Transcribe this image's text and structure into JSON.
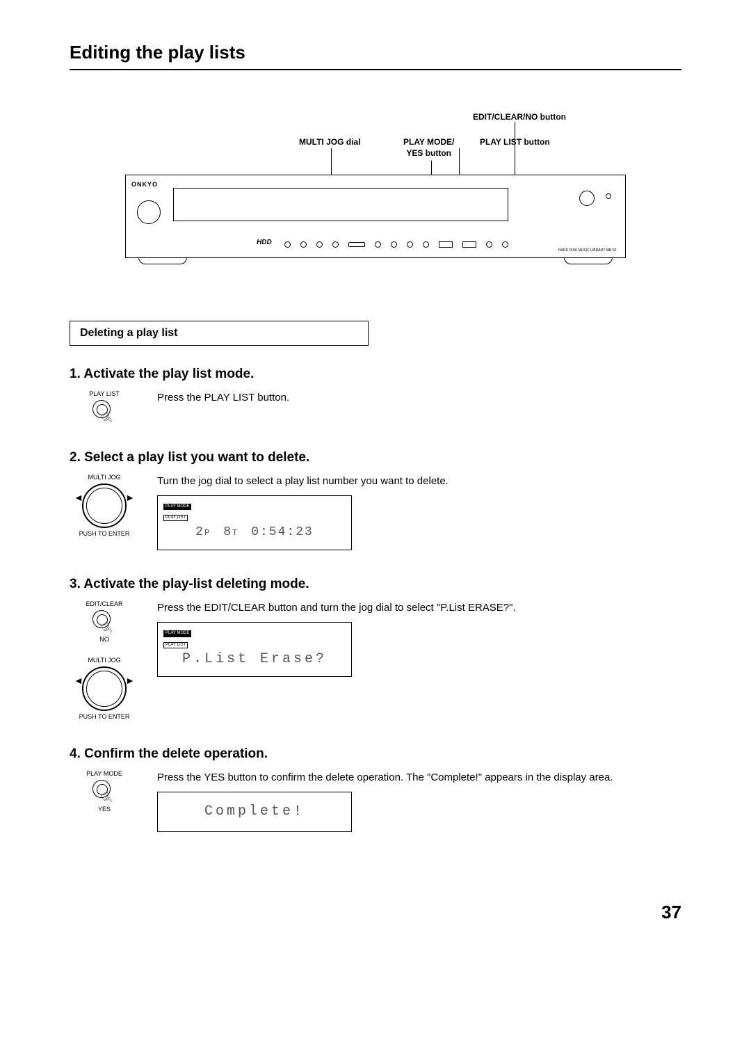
{
  "title": "Editing the play lists",
  "page_number": "37",
  "diagram": {
    "callout_edit": "EDIT/CLEAR/NO button",
    "callout_multi_jog": "MULTI JOG dial",
    "callout_play_mode": "PLAY MODE/\nYES button",
    "callout_play_list": "PLAY LIST button",
    "brand": "ONKYO",
    "hdd": "HDD",
    "model": "HARD DISK MUSIC LIBRARY MB-S1"
  },
  "section_box": "Deleting a play list",
  "steps": [
    {
      "heading": "1. Activate the play list mode.",
      "icon_label_top": "PLAY LIST",
      "body": "Press the PLAY LIST button."
    },
    {
      "heading": "2. Select a play list you want to delete.",
      "icon_label_top": "MULTI JOG",
      "icon_label_bottom": "PUSH TO ENTER",
      "body": "Turn the jog dial to select a play list number you want to delete.",
      "display": {
        "tags": [
          "PLAY MODE",
          "PLAY LIST"
        ],
        "v1": "2",
        "u1": "P",
        "v2": "8",
        "u2": "T",
        "v3": "0:54:23"
      }
    },
    {
      "heading": "3. Activate the play-list deleting mode.",
      "icon1_top": "EDIT/CLEAR",
      "icon1_bottom": "NO",
      "icon2_top": "MULTI JOG",
      "icon2_bottom": "PUSH TO ENTER",
      "body": "Press the EDIT/CLEAR button and turn the jog dial to select \"P.List ERASE?\".",
      "display": {
        "tags": [
          "PLAY MODE",
          "PLAY LIST"
        ],
        "text": "P.List Erase?"
      }
    },
    {
      "heading": "4. Confirm the delete operation.",
      "icon_label_top": "PLAY MODE",
      "icon_label_bottom": "YES",
      "body": "Press the YES button to confirm the delete operation. The \"Complete!\" appears in the display area.",
      "display": {
        "text": "Complete!"
      }
    }
  ]
}
